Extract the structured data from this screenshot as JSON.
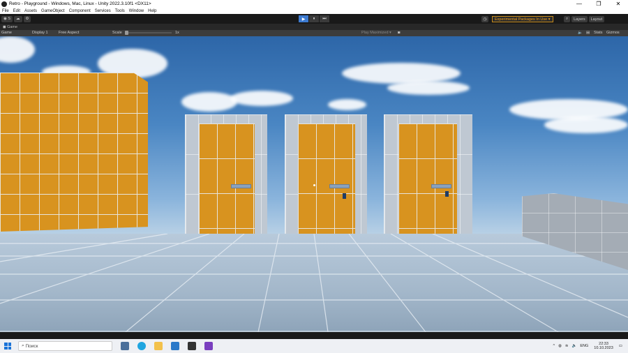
{
  "window": {
    "title": "Retro - Playground - Windows, Mac, Linux - Unity 2022.3.10f1 <DX11>",
    "controls": [
      "—",
      "❐",
      "✕"
    ]
  },
  "menu": [
    "File",
    "Edit",
    "Assets",
    "GameObject",
    "Component",
    "Services",
    "Tools",
    "Window",
    "Help"
  ],
  "toolbar": {
    "account_label": "S",
    "play_buttons": [
      "▶",
      "⏸",
      "⏭"
    ],
    "experimental_packages": "Experimental Packages In Use ▾",
    "layers": "Layers",
    "layout": "Layout"
  },
  "game_view": {
    "tab_label": "Game",
    "mode": "Game",
    "display": "Display 1",
    "aspect": "Free Aspect",
    "scale_label": "Scale",
    "scale_value": "1x",
    "play_maximized": "Play Maximized ▾",
    "stats": "Stats",
    "gizmos": "Gizmos"
  },
  "taskbar": {
    "search_placeholder": "Поиск",
    "language": "ENG",
    "time": "22:33",
    "date": "10.10.2023"
  }
}
